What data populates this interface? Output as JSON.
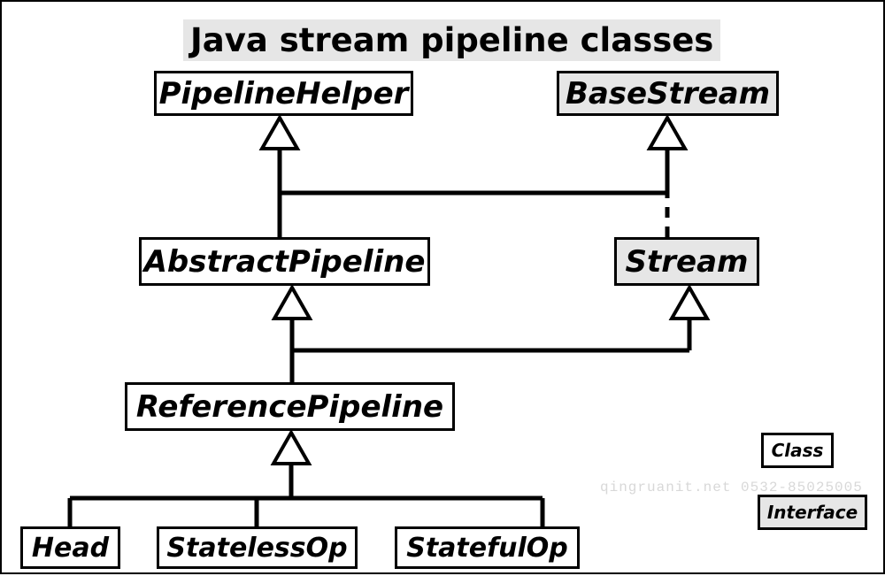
{
  "title": "Java stream pipeline classes",
  "nodes": {
    "pipelineHelper": {
      "label": "PipelineHelper",
      "kind": "class"
    },
    "baseStream": {
      "label": "BaseStream",
      "kind": "interface"
    },
    "abstractPipeline": {
      "label": "AbstractPipeline",
      "kind": "class"
    },
    "stream": {
      "label": "Stream",
      "kind": "interface"
    },
    "referencePipeline": {
      "label": "ReferencePipeline",
      "kind": "class"
    },
    "head": {
      "label": "Head",
      "kind": "class"
    },
    "statelessOp": {
      "label": "StatelessOp",
      "kind": "class"
    },
    "statefulOp": {
      "label": "StatefulOp",
      "kind": "class"
    }
  },
  "legend": {
    "class": "Class",
    "interface": "Interface"
  },
  "watermark": "qingruanit.net 0532-85025005",
  "edges": [
    {
      "from": "abstractPipeline",
      "to": "pipelineHelper",
      "style": "solid"
    },
    {
      "from": "abstractPipeline",
      "to": "baseStream",
      "style": "solid"
    },
    {
      "from": "stream",
      "to": "baseStream",
      "style": "dashed"
    },
    {
      "from": "referencePipeline",
      "to": "abstractPipeline",
      "style": "solid"
    },
    {
      "from": "referencePipeline",
      "to": "stream",
      "style": "solid"
    },
    {
      "from": "head",
      "to": "referencePipeline",
      "style": "solid"
    },
    {
      "from": "statelessOp",
      "to": "referencePipeline",
      "style": "solid"
    },
    {
      "from": "statefulOp",
      "to": "referencePipeline",
      "style": "solid"
    }
  ]
}
